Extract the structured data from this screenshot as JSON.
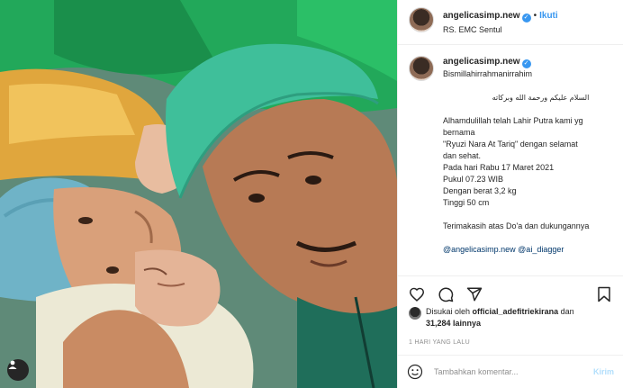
{
  "post": {
    "username": "angelicasimp.new",
    "follow_label": "Ikuti",
    "separator": "•",
    "location": "RS. EMC Sentul",
    "caption_lines": [
      "Bismillahirrahmanirrahim",
      "",
      "",
      "",
      "Alhamdulillah telah Lahir Putra kami yg",
      "bernama",
      "\"Ryuzi Nara At Tariq\" dengan selamat",
      "dan sehat.",
      "Pada hari Rabu 17 Maret 2021",
      "Pukul 07.23 WIB",
      "Dengan berat 3,2 kg",
      "Tinggi 50 cm",
      "",
      "Terimakasih atas Do'a dan dukungannya",
      "",
      "@angelicasimp.new @ai_diagger"
    ],
    "arabic_line": "السلام عليكم ورحمة الله وبركاته",
    "likes_prefix": "Disukai oleh",
    "likes_user": "official_adefitriekirana",
    "likes_and": "dan",
    "likes_count": "31,284",
    "likes_suffix": "lainnya",
    "timestamp": "1 HARI YANG LALU",
    "comment_placeholder": "Tambahkan komentar...",
    "post_label": "Kirim"
  },
  "icons": {
    "verified": "verified-badge-icon",
    "like": "heart-icon",
    "comment": "comment-icon",
    "share": "share-icon",
    "save": "bookmark-icon",
    "emoji": "emoji-icon",
    "tag": "user-tag-icon"
  },
  "colors": {
    "link": "#3897f0",
    "mention": "#00376b",
    "muted": "#8e8e8e"
  }
}
